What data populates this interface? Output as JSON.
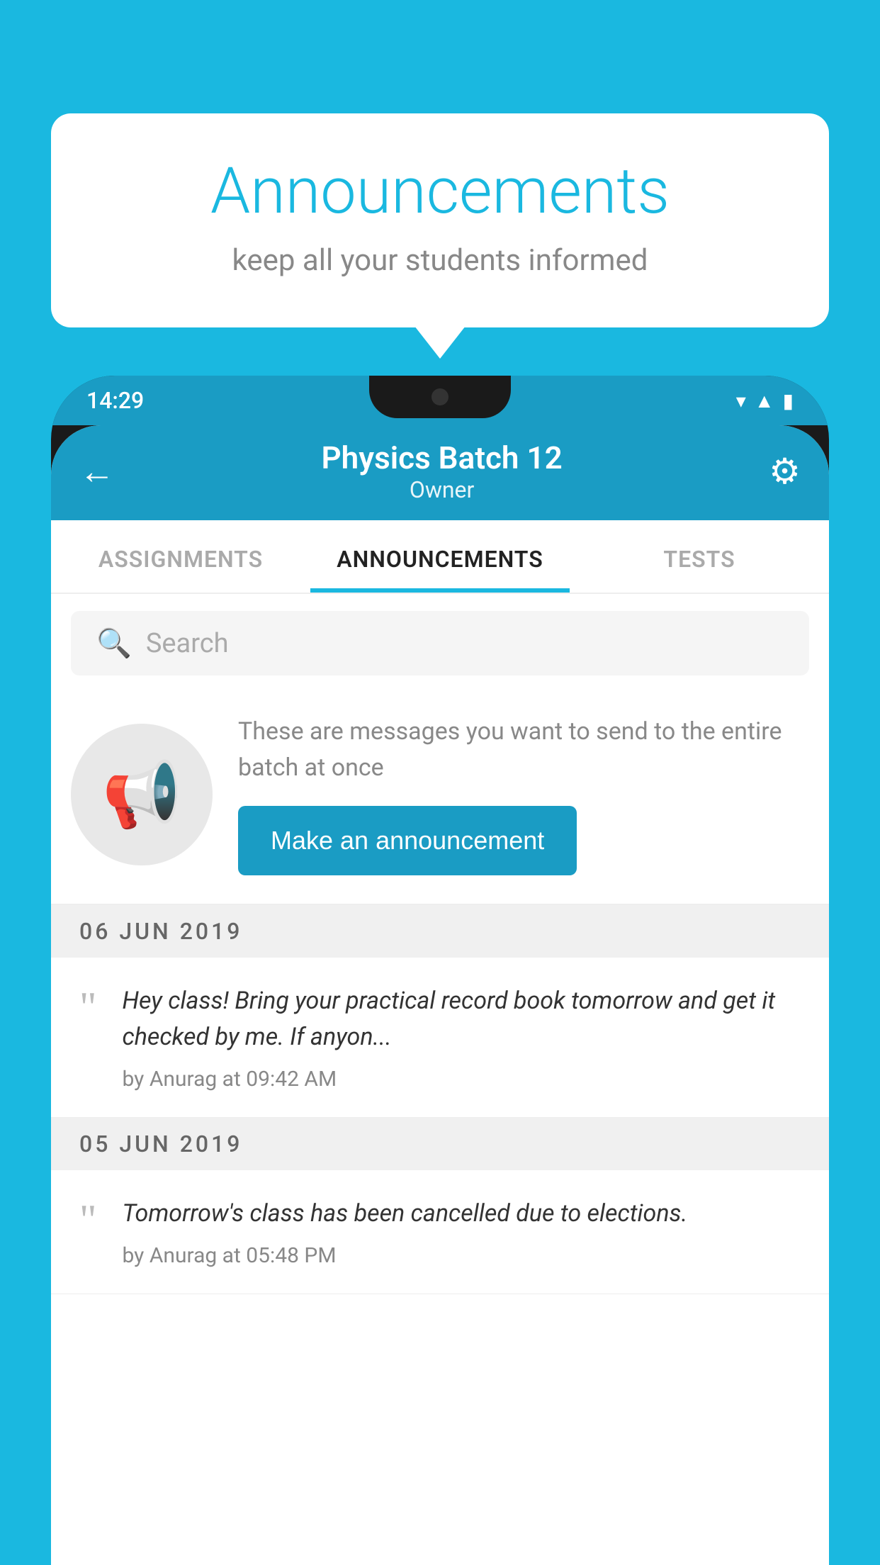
{
  "bubble": {
    "title": "Announcements",
    "subtitle": "keep all your students informed"
  },
  "status_bar": {
    "time": "14:29",
    "icons": [
      "wifi",
      "signal",
      "battery"
    ]
  },
  "header": {
    "title": "Physics Batch 12",
    "subtitle": "Owner",
    "back_label": "←",
    "gear_label": "⚙"
  },
  "tabs": [
    {
      "label": "ASSIGNMENTS",
      "active": false
    },
    {
      "label": "ANNOUNCEMENTS",
      "active": true
    },
    {
      "label": "TESTS",
      "active": false
    }
  ],
  "search": {
    "placeholder": "Search"
  },
  "promo": {
    "description": "These are messages you want to send to the entire batch at once",
    "button_label": "Make an announcement"
  },
  "announcements": [
    {
      "date": "06  JUN  2019",
      "text": "Hey class! Bring your practical record book tomorrow and get it checked by me. If anyon...",
      "author": "by Anurag at 09:42 AM"
    },
    {
      "date": "05  JUN  2019",
      "text": "Tomorrow's class has been cancelled due to elections.",
      "author": "by Anurag at 05:48 PM"
    }
  ],
  "colors": {
    "brand_blue": "#1ab8e0",
    "header_blue": "#1a9cc4",
    "button_blue": "#1a9cc4"
  }
}
